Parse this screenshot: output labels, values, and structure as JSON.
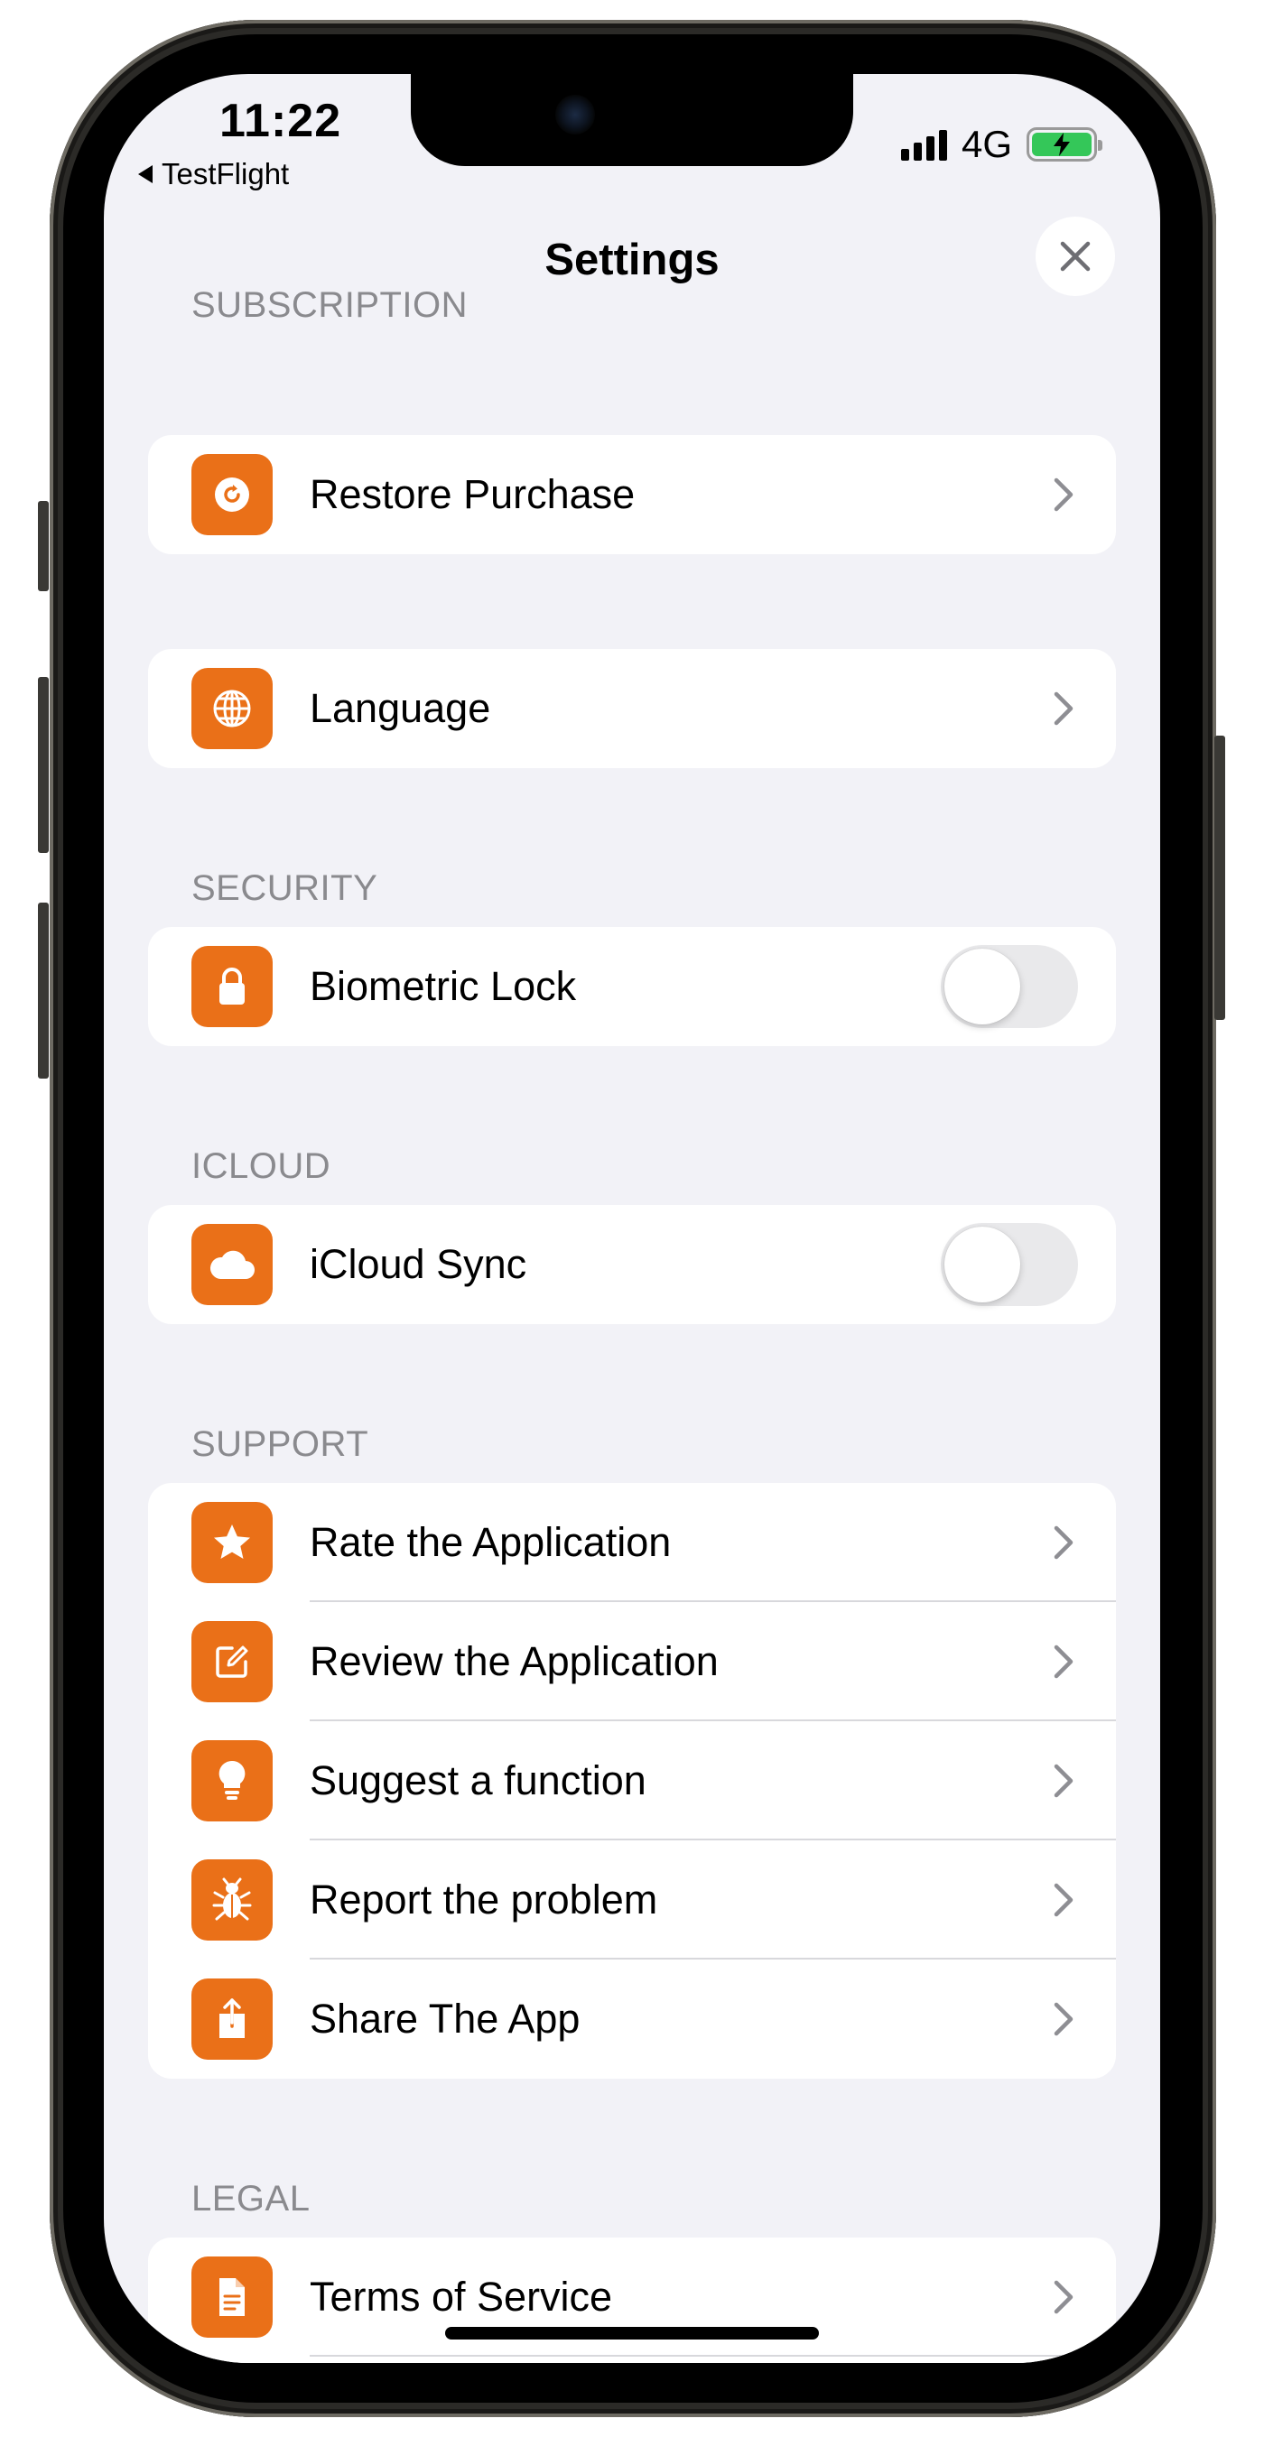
{
  "status_bar": {
    "time": "11:22",
    "back_app": "TestFlight",
    "network": "4G"
  },
  "nav": {
    "title": "Settings"
  },
  "sections": {
    "subscription": {
      "header": "SUBSCRIPTION",
      "restore": "Restore Purchase"
    },
    "general": {
      "language": "Language"
    },
    "security": {
      "header": "SECURITY",
      "biometric": "Biometric Lock",
      "biometric_on": false
    },
    "icloud": {
      "header": "ICLOUD",
      "sync": "iCloud Sync",
      "sync_on": false
    },
    "support": {
      "header": "SUPPORT",
      "rate": "Rate the Application",
      "review": "Review the Application",
      "suggest": "Suggest a function",
      "report": "Report the problem",
      "share": "Share The App"
    },
    "legal": {
      "header": "LEGAL",
      "terms": "Terms of Service"
    }
  },
  "colors": {
    "accent": "#ea7018",
    "background": "#f2f2f7",
    "section_header": "#8a8a8e",
    "battery": "#34c759"
  },
  "icons": {
    "restore": "restore-icon",
    "language": "globe-icon",
    "biometric": "lock-icon",
    "icloud": "cloud-icon",
    "rate": "star-icon",
    "review": "edit-icon",
    "suggest": "lightbulb-icon",
    "report": "bug-icon",
    "share": "share-icon",
    "terms": "document-icon"
  }
}
